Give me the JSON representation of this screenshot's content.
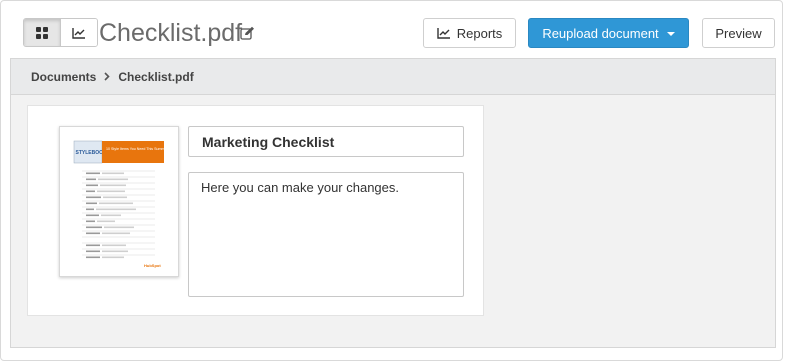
{
  "header": {
    "doc_title": "Checklist.pdf",
    "reports_label": "Reports",
    "reupload_label": "Reupload document",
    "preview_label": "Preview"
  },
  "breadcrumb": {
    "items": [
      "Documents",
      "Checklist.pdf"
    ]
  },
  "document": {
    "name_value": "Marketing Checklist",
    "description_value": "Here you can make your changes.",
    "thumbnail": {
      "logo_text": "STYLEBOOK",
      "banner_text": "10 Style Items You Need This Summer",
      "footer_logo": "HubSpot"
    }
  },
  "colors": {
    "primary": "#2f97d6",
    "thumb_banner": "#e8750d"
  },
  "icons": {
    "grid": "grid-icon",
    "chart": "line-chart-icon",
    "edit": "edit-icon"
  }
}
